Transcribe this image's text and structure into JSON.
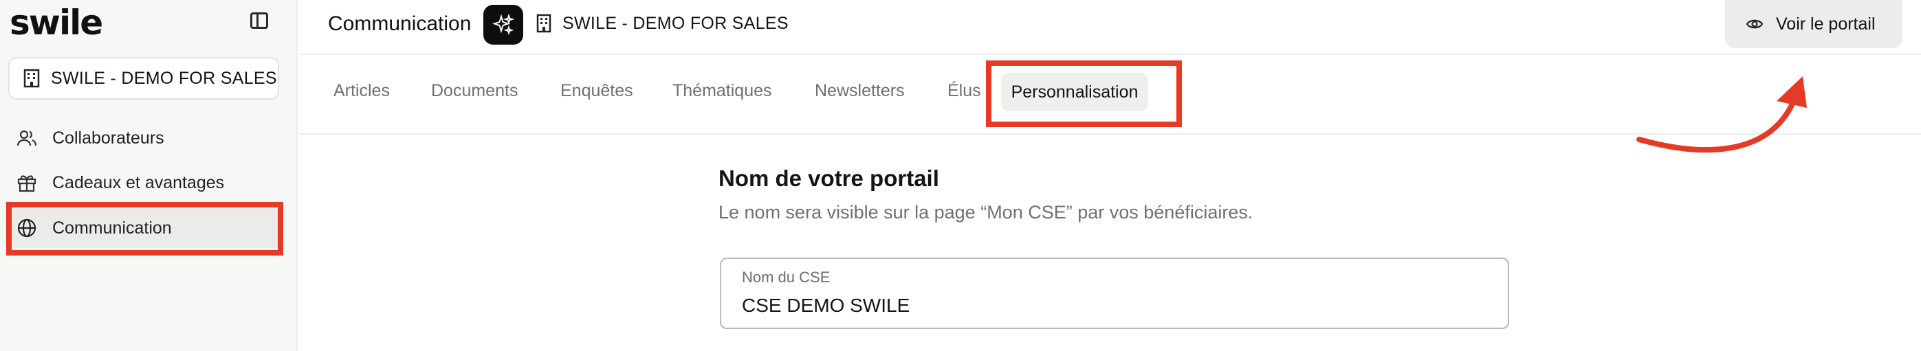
{
  "app": {
    "logo": "swile"
  },
  "sidebar": {
    "company": "SWILE - DEMO FOR SALES",
    "items": [
      {
        "label": "Collaborateurs",
        "icon": "users-icon"
      },
      {
        "label": "Cadeaux et avantages",
        "icon": "gift-icon"
      },
      {
        "label": "Communication",
        "icon": "globe-icon",
        "active": true
      }
    ]
  },
  "header": {
    "title": "Communication",
    "org_name": "SWILE - DEMO FOR SALES",
    "portal_button": "Voir le portail"
  },
  "tabs": [
    {
      "label": "Articles"
    },
    {
      "label": "Documents"
    },
    {
      "label": "Enquêtes"
    },
    {
      "label": "Thématiques"
    },
    {
      "label": "Newsletters"
    },
    {
      "label": "Élus"
    },
    {
      "label": "Personnalisation",
      "active": true
    }
  ],
  "main": {
    "section_title": "Nom de votre portail",
    "section_description": "Le nom sera visible sur la page “Mon CSE” par vos bénéficiaires.",
    "field": {
      "label": "Nom du CSE",
      "value": "CSE DEMO SWILE"
    }
  },
  "colors": {
    "highlight": "#e53a24",
    "sidebar_bg": "#f7f7f6",
    "active_bg": "#ebebea"
  }
}
